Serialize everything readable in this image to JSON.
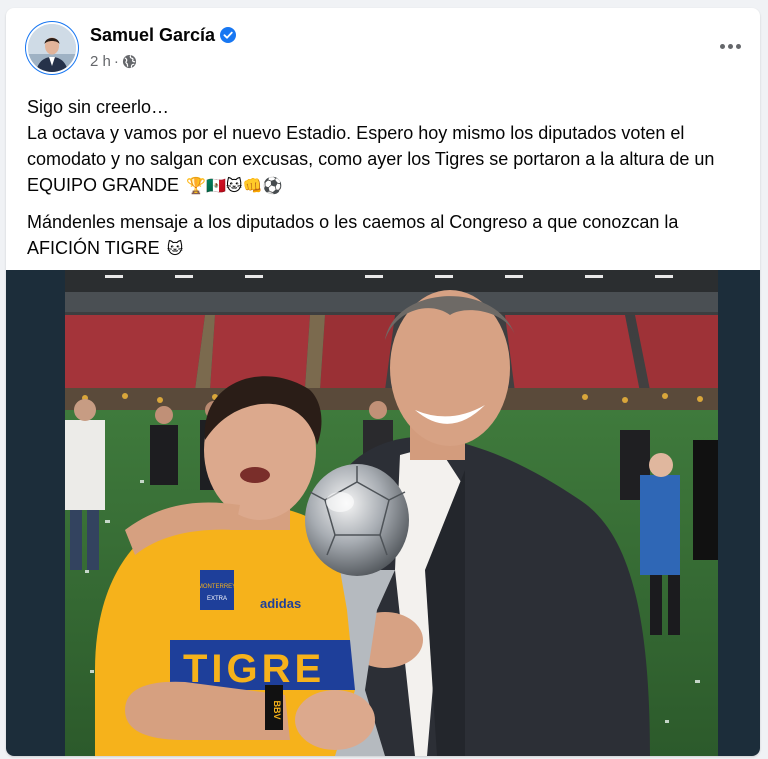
{
  "post": {
    "author": "Samuel García",
    "verified": true,
    "time": "2 h",
    "separator": "·",
    "audience_icon": "globe-icon",
    "more_icon": "more-options-icon",
    "paragraph1_line1": "Sigo sin creerlo…",
    "paragraph1_line2": "La octava y vamos por el nuevo Estadio. Espero hoy mismo los diputados voten el comodato y no salgan con excusas, como ayer los Tigres se portaron a la altura de un EQUIPO GRANDE",
    "paragraph1_emojis": "🏆🇲🇽🐱👊⚽",
    "paragraph2": "Mándenles mensaje a los diputados o les caemos al Congreso a que conozcan la AFICIÓN TIGRE",
    "paragraph2_emoji": "🐱"
  },
  "photo": {
    "shirt_text": "TIGRE",
    "sponsor_text": "MONTERREY",
    "sponsor_sub": "EXTRA",
    "brand_text": "adidas",
    "wristband_text": "BBV"
  },
  "colors": {
    "accent": "#1877f2",
    "meta_text": "#65676b",
    "card_bg": "#ffffff",
    "page_bg": "#f0f2f5",
    "jersey_yellow": "#f6b21b",
    "jersey_blue": "#1e3f9a"
  }
}
